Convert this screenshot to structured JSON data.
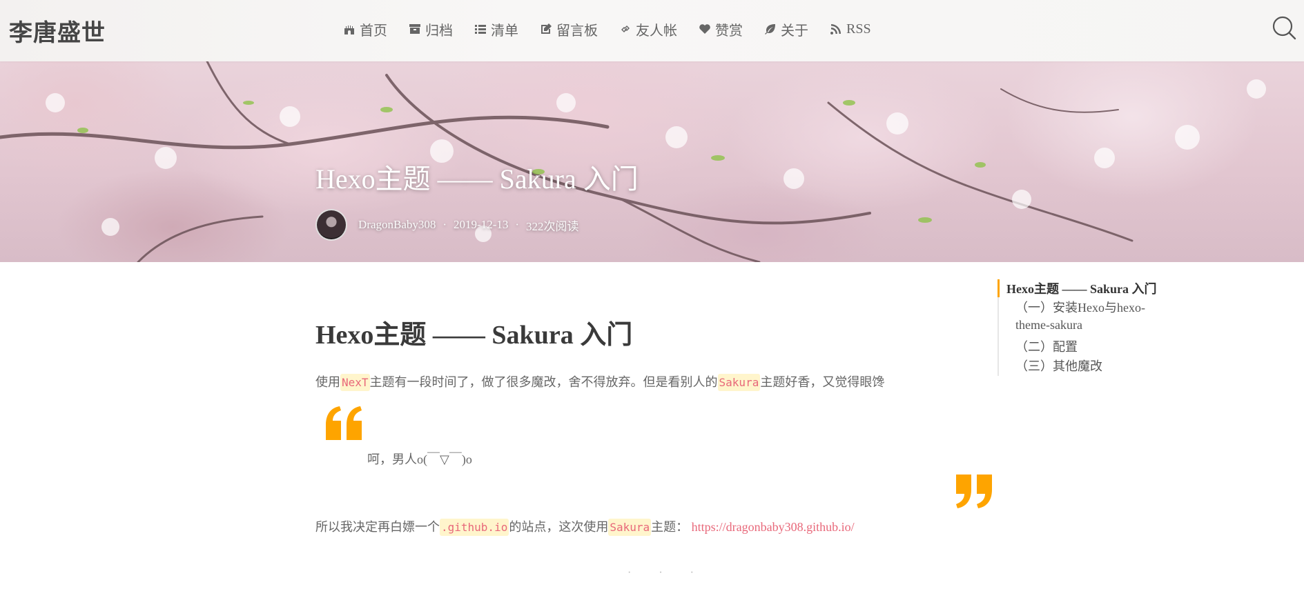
{
  "header": {
    "site_title": "李唐盛世",
    "nav": [
      {
        "label": "首页",
        "icon": "fort-icon"
      },
      {
        "label": "归档",
        "icon": "archive-icon"
      },
      {
        "label": "清单",
        "icon": "list-icon"
      },
      {
        "label": "留言板",
        "icon": "edit-icon"
      },
      {
        "label": "友人帐",
        "icon": "link-icon"
      },
      {
        "label": "赞赏",
        "icon": "heart-icon"
      },
      {
        "label": "关于",
        "icon": "leaf-icon"
      },
      {
        "label": "RSS",
        "icon": "rss-icon"
      }
    ],
    "search_icon": "search-icon"
  },
  "hero": {
    "title": "Hexo主题 —— Sakura 入门",
    "author": "DragonBaby308",
    "date": "2019-12-13",
    "reads": "322次阅读",
    "separator": "·"
  },
  "article": {
    "title": "Hexo主题 —— Sakura 入门",
    "p1": {
      "t1": "使用",
      "c1": "NexT",
      "t2": "主题有一段时间了，做了很多魔改，舍不得放弃。但是看别人的",
      "c2": "Sakura",
      "t3": "主题好香，又觉得眼馋"
    },
    "quote": "呵，男人o(￣▽￣)o",
    "p3": {
      "t1": "所以我决定再白嫖一个",
      "c1": ".github.io",
      "t2": "的站点，这次使用",
      "c2": "Sakura",
      "t3": "主题：",
      "link": "https://dragonbaby308.github.io/"
    },
    "divider": "· · ·"
  },
  "toc": {
    "main": "Hexo主题 —— Sakura 入门",
    "item1_line1": "（一）安装Hexo与hexo-",
    "item1_line2": "theme-sakura",
    "item2": "（二）配置",
    "item3": "（三）其他魔改"
  },
  "colors": {
    "accent_orange": "#fea400",
    "code_bg": "#fff5cc",
    "code_text": "#e8687a",
    "link": "#e8687a"
  }
}
